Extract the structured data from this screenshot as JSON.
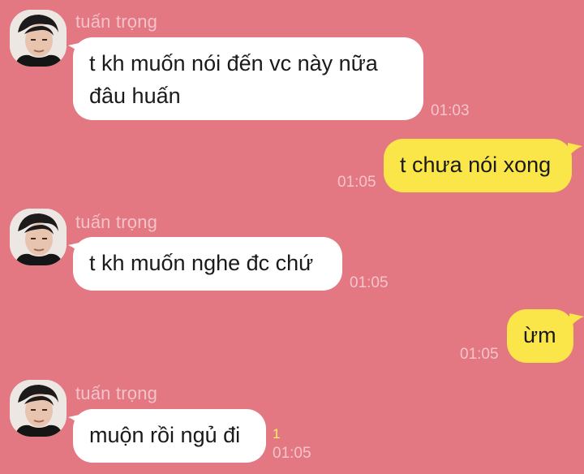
{
  "colors": {
    "background": "#e37782",
    "incoming_bubble": "#ffffff",
    "outgoing_bubble": "#fbe64a",
    "timestamp": "#f6c4ca",
    "sender_name": "#f4c3c9",
    "unread_count": "#fff36a"
  },
  "messages": [
    {
      "direction": "incoming",
      "sender": "tuấn trọng",
      "text_line1": "t kh muốn nói đến vc này nữa",
      "text_line2": "đâu huấn",
      "time": "01:03"
    },
    {
      "direction": "outgoing",
      "text": "t chưa nói xong",
      "time": "01:05"
    },
    {
      "direction": "incoming",
      "sender": "tuấn trọng",
      "text": "t kh muốn nghe đc chứ",
      "time": "01:05"
    },
    {
      "direction": "outgoing",
      "text": "ừm",
      "time": "01:05"
    },
    {
      "direction": "incoming",
      "sender": "tuấn trọng",
      "text": "muộn rồi ngủ đi",
      "unread": "1",
      "time": "01:05"
    }
  ],
  "icons": {
    "avatar": "avatar-photo"
  }
}
